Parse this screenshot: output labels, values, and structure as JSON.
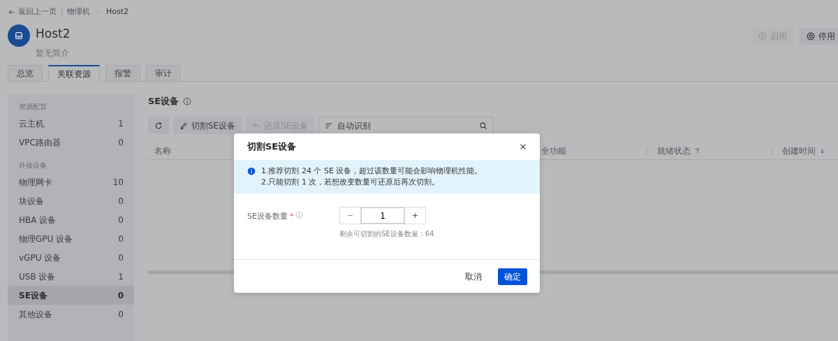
{
  "breadcrumb": {
    "back": "返回上一页",
    "items": [
      "物理机",
      "Host2"
    ]
  },
  "header": {
    "title": "Host2",
    "description": "暂无简介",
    "actions": [
      {
        "kind": "start",
        "label": "启用",
        "disabled": true
      },
      {
        "kind": "stop",
        "label": "停用",
        "disabled": false
      }
    ]
  },
  "tabs": [
    {
      "label": "总览",
      "selected": false
    },
    {
      "label": "关联资源",
      "selected": true
    },
    {
      "label": "报警",
      "selected": false
    },
    {
      "label": "审计",
      "selected": false
    }
  ],
  "sidebar": {
    "sections": [
      {
        "title": "资源配置",
        "items": [
          {
            "label": "云主机",
            "count": "1",
            "selected": false
          },
          {
            "label": "VPC路由器",
            "count": "0",
            "selected": false
          }
        ]
      },
      {
        "title": "外接设备",
        "items": [
          {
            "label": "物理网卡",
            "count": "10",
            "selected": false
          },
          {
            "label": "块设备",
            "count": "0",
            "selected": false
          },
          {
            "label": "HBA 设备",
            "count": "0",
            "selected": false
          },
          {
            "label": "物理GPU 设备",
            "count": "0",
            "selected": false
          },
          {
            "label": "vGPU 设备",
            "count": "0",
            "selected": false
          },
          {
            "label": "USB 设备",
            "count": "1",
            "selected": false
          },
          {
            "label": "SE设备",
            "count": "0",
            "selected": true
          },
          {
            "label": "其他设备",
            "count": "0",
            "selected": false
          }
        ]
      }
    ]
  },
  "content": {
    "title": "SE设备",
    "toolbar": [
      {
        "kind": "refresh",
        "disabled": false
      },
      {
        "kind": "cut",
        "label": "切割SE设备",
        "disabled": false
      },
      {
        "kind": "restore",
        "label": "还原SE设备",
        "disabled": true
      }
    ],
    "search": {
      "filter": "自动识别"
    },
    "columns": [
      {
        "label": "名称"
      },
      {
        "label": "全功能"
      },
      {
        "label": "就绪状态",
        "kind": "filter"
      },
      {
        "label": "创建时间",
        "kind": "sort"
      }
    ]
  },
  "dialog": {
    "title": "切割SE设备",
    "notices": [
      "1.推荐切割 24 个 SE 设备，超过该数量可能会影响物理机性能。",
      "2.只能切割 1 次，若想改变数量可还原后再次切割。"
    ],
    "field": {
      "label": "SE设备数量",
      "required_mark": "*",
      "value": "1",
      "help": "剩余可切割的SE设备数量：64"
    },
    "buttons": [
      {
        "kind": "text",
        "label": "取消"
      },
      {
        "kind": "primary",
        "label": "确定"
      }
    ]
  }
}
